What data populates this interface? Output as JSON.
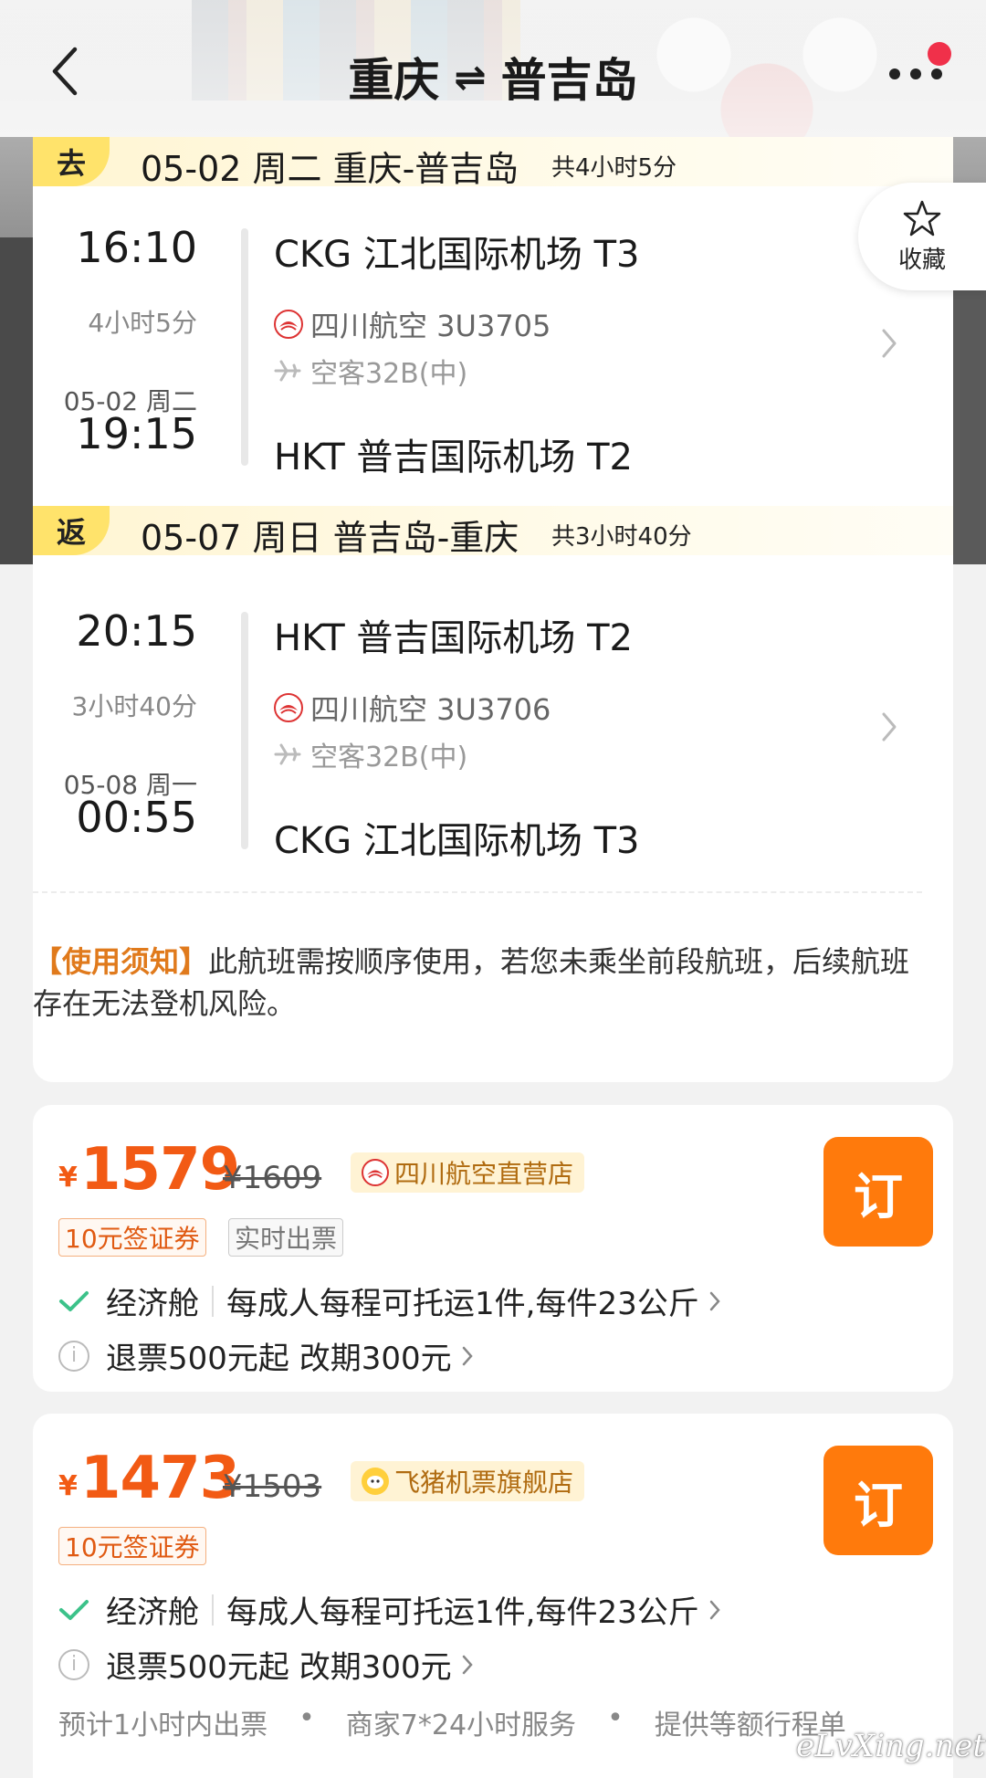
{
  "header": {
    "from": "重庆",
    "to": "普吉岛",
    "swap_icon": "⇌"
  },
  "favorite": {
    "label": "收藏"
  },
  "outbound": {
    "tag": "去",
    "date_route": "05-02 周二 重庆-普吉岛",
    "total": "共4小时5分",
    "dep_time": "16:10",
    "dep_airport": "CKG 江北国际机场 T3",
    "duration": "4小时5分",
    "airline": "四川航空 3U3705",
    "aircraft": "空客32B(中)",
    "arr_date": "05-02 周二",
    "arr_time": "19:15",
    "arr_airport": "HKT 普吉国际机场 T2"
  },
  "return": {
    "tag": "返",
    "date_route": "05-07 周日 普吉岛-重庆",
    "total": "共3小时40分",
    "dep_time": "20:15",
    "dep_airport": "HKT 普吉国际机场 T2",
    "duration": "3小时40分",
    "airline": "四川航空 3U3706",
    "aircraft": "空客32B(中)",
    "arr_date": "05-08 周一",
    "arr_time": "00:55",
    "arr_airport": "CKG 江北国际机场 T3"
  },
  "notice": {
    "label": "【使用须知】",
    "text": "此航班需按顺序使用，若您未乘坐前段航班，后续航班存在无法登机风险。"
  },
  "offers": [
    {
      "currency": "¥",
      "price": "1579",
      "old_price": "¥1609",
      "shop": "四川航空直营店",
      "tags": [
        "10元签证券",
        "实时出票"
      ],
      "cabin": "经济舱",
      "baggage": "每成人每程可托运1件,每件23公斤",
      "refund": "退票500元起 改期300元",
      "book": "订"
    },
    {
      "currency": "¥",
      "price": "1473",
      "old_price": "¥1503",
      "shop": "飞猪机票旗舰店",
      "tags": [
        "10元签证券"
      ],
      "cabin": "经济舱",
      "baggage": "每成人每程可托运1件,每件23公斤",
      "refund": "退票500元起 改期300元",
      "book": "订",
      "footer": [
        "预计1小时内出票",
        "•",
        "商家7*24小时服务",
        "•",
        "提供等额行程单"
      ]
    }
  ],
  "watermark": "eLvXing.net",
  "colors": {
    "accent": "#ff7a0c",
    "price": "#f25a14",
    "tag_yellow": "#ffe36b"
  }
}
